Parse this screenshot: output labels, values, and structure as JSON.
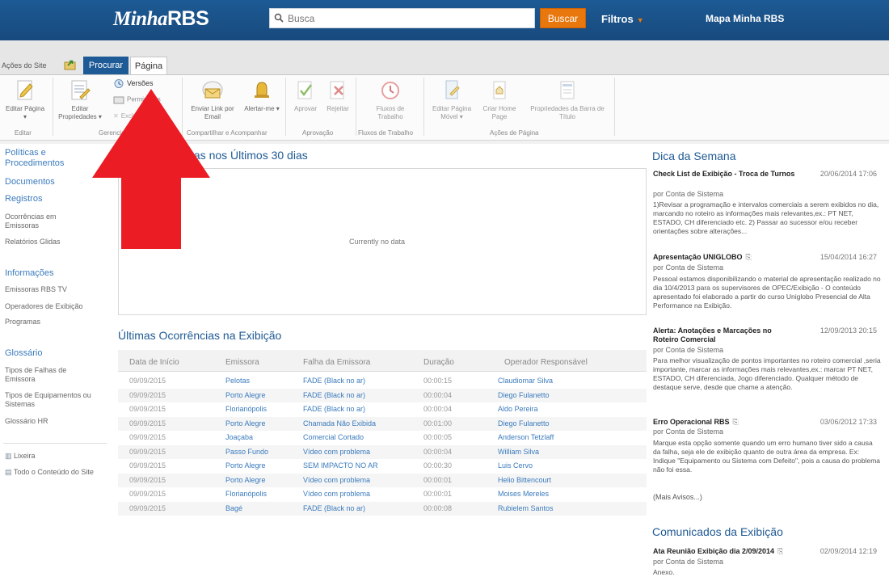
{
  "header": {
    "logo_part1": "Minha",
    "logo_part2": "RBS",
    "search_placeholder": "Busca",
    "search_button": "Buscar",
    "filters_label": "Filtros",
    "map_label": "Mapa Minha RBS",
    "brand_color": "#1d5a94",
    "accent_color": "#e8770d"
  },
  "ribbon": {
    "site_actions": "Ações do Site",
    "tabs": [
      "Procurar",
      "Página"
    ],
    "active_tab": "Procurar",
    "groups": {
      "editar": {
        "label": "Editar",
        "edit_page": "Editar Página",
        "edit_page_caret": "▾"
      },
      "gerenciar": {
        "label": "Gerenciar",
        "edit_properties_line1": "Editar",
        "edit_properties_line2": "Propriedades ▾",
        "versions": "Versões",
        "permissions": "Permissões",
        "delete_page": "Excluir Página"
      },
      "compartilhar": {
        "label": "Compartilhar e Acompanhar",
        "email_link": "Enviar Link por Email",
        "alert_me": "Alertar-me ▾"
      },
      "aprovacao": {
        "label": "Aprovação",
        "approve": "Aprovar",
        "reject": "Rejeitar"
      },
      "fluxos": {
        "label": "Fluxos de Trabalho",
        "workflows": "Fluxos de Trabalho"
      },
      "acoes": {
        "label": "Ações de Página",
        "edit_mobile": "Editar Página Móvel ▾",
        "create_home": "Criar Home Page",
        "title_bar": "Propriedades da Barra de Título"
      }
    }
  },
  "leftnav": {
    "sections": [
      {
        "heading": "Políticas e Procedimentos"
      },
      {
        "heading": "Documentos"
      },
      {
        "heading": "Registros",
        "items": [
          "Ocorrências em Emissoras",
          "Relatórios Glidas"
        ]
      },
      {
        "heading": "Informações",
        "items": [
          "Emissoras RBS TV",
          "Operadores de Exibição",
          "Programas"
        ]
      },
      {
        "heading": "Glossário",
        "items": [
          "Tipos de Falhas de Emissora",
          "Tipos de Equipamentos ou Sistemas",
          "Glossário HR"
        ]
      }
    ],
    "bottom": [
      "Lixeira",
      "Todo o Conteúdo do Site"
    ]
  },
  "main": {
    "recent_title": "lhas nos Últimos 30 dias",
    "no_data": "Currently no data",
    "table_title": "Últimas Ocorrências na Exibição",
    "columns": [
      "Data de Início",
      "Emissora",
      "Falha da Emissora",
      "Duração",
      "Operador Responsável"
    ],
    "rows": [
      [
        "09/09/2015",
        "Pelotas",
        "FADE (Black no ar)",
        "00:00:15",
        "Claudiomar Silva"
      ],
      [
        "09/09/2015",
        "Porto Alegre",
        "FADE (Black no ar)",
        "00:00:04",
        "Diego Fulanetto"
      ],
      [
        "09/09/2015",
        "Florianópolis",
        "FADE (Black no ar)",
        "00:00:04",
        "Aldo Pereira"
      ],
      [
        "09/09/2015",
        "Porto Alegre",
        "Chamada Não Exibida",
        "00:01:00",
        "Diego Fulanetto"
      ],
      [
        "09/09/2015",
        "Joaçaba",
        "Comercial Cortado",
        "00:00:05",
        "Anderson Tetzlaff"
      ],
      [
        "09/09/2015",
        "Passo Fundo",
        "Vídeo com problema",
        "00:00:04",
        "William Silva"
      ],
      [
        "09/09/2015",
        "Porto Alegre",
        "SEM IMPACTO NO AR",
        "00:00:30",
        "Luis Cervo"
      ],
      [
        "09/09/2015",
        "Porto Alegre",
        "Vídeo com problema",
        "00:00:01",
        "Helio Bittencourt"
      ],
      [
        "09/09/2015",
        "Florianópolis",
        "Vídeo com problema",
        "00:00:01",
        "Moises Mereles"
      ],
      [
        "09/09/2015",
        "Bagé",
        "FADE (Black no ar)",
        "00:00:08",
        "Rubielem Santos"
      ]
    ]
  },
  "right": {
    "dica_title": "Dica da Semana",
    "news": [
      {
        "title": "Check List de Exibição - Troca de Turnos",
        "date": "20/06/2014 17:06",
        "by": "por Conta de Sistema",
        "body": "1)Revisar a programação e intervalos comerciais a serem exibidos no dia, marcando no roteiro as informações mais relevantes,ex.: PT NET, ESTADO, CH diferenciado etc. 2) Passar ao sucessor e/ou receber orientações sobre alterações..."
      },
      {
        "title": "Apresentação UNIGLOBO",
        "date": "15/04/2014 16:27",
        "by": "por Conta de Sistema",
        "body": "Pessoal estamos disponibilizando o material de apresentação realizado no dia 10/4/2013 para os supervisores de OPEC/Exibição - O conteúdo apresentado foi elaborado a partir do curso Uniglobo Presencial de Alta Performance na Exibição."
      },
      {
        "title": "Alerta: Anotações e Marcações no Roteiro Comercial",
        "date": "12/09/2013 20:15",
        "by": "por Conta de Sistema",
        "body": "Para melhor visualização de pontos importantes no roteiro comercial ,seria importante, marcar as informações mais relevantes,ex.: marcar PT NET, ESTADO, CH diferenciada, Jogo diferenciado. Qualquer método de destaque serve, desde que chame a atenção."
      },
      {
        "title": "Erro Operacional RBS",
        "date": "03/06/2012 17:33",
        "by": "por Conta de Sistema",
        "body": "Marque esta opção somente quando um erro humano tiver sido a causa da falha, seja ele de exibição quanto de outra área da empresa. Ex: Indique \"Equipamento ou Sistema com Defeito\", pois a causa do problema não foi essa."
      }
    ],
    "more": "(Mais Avisos...)",
    "comunicados_title": "Comunicados da Exibição",
    "comunicado": {
      "title": "Ata Reunião Exibição dia 2/09/2014",
      "date": "02/09/2014 12:19",
      "by": "por Conta de Sistema",
      "body": "Anexo."
    }
  }
}
